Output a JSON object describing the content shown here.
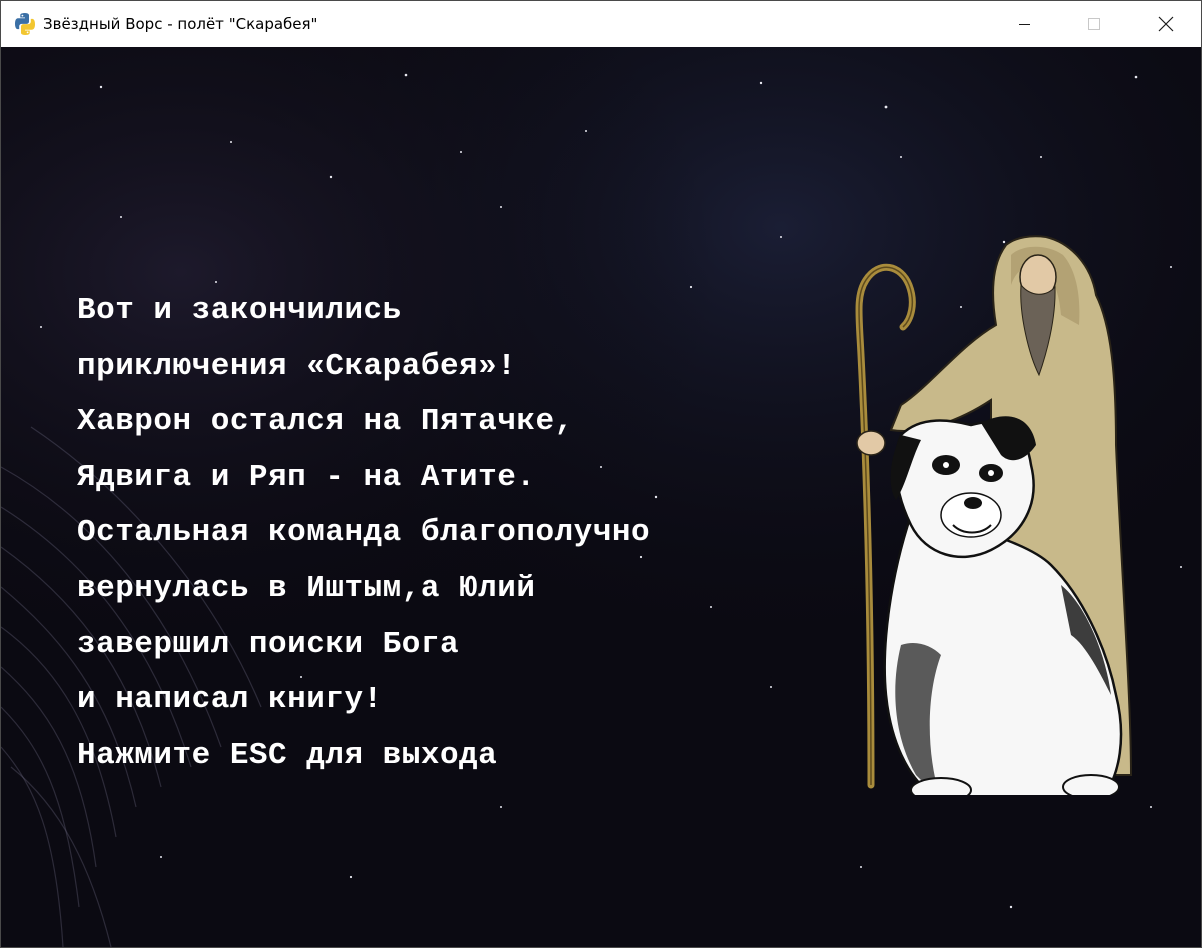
{
  "window": {
    "title": "Звёздный Ворс - полёт \"Скарабея\"",
    "app_icon": "python-icon"
  },
  "story": {
    "lines": [
      "Вот и закончились",
      "приключения «Скарабея»!",
      "Хаврон остался на Пятачке,",
      "Ядвига и Ряп - на Атите.",
      "Остальная команда благополучно",
      "вернулась в Иштым,а Юлий",
      "завершил поиски Бога",
      "и написал книгу!",
      "Нажмите ESC для выхода"
    ]
  },
  "illustration": {
    "figures": [
      "hooded-old-man-with-staff",
      "black-and-white-dog"
    ]
  },
  "colors": {
    "background": "#0b0a12",
    "text": "#ffffff",
    "robe": "#c8b98a",
    "staff": "#a98c3c"
  }
}
